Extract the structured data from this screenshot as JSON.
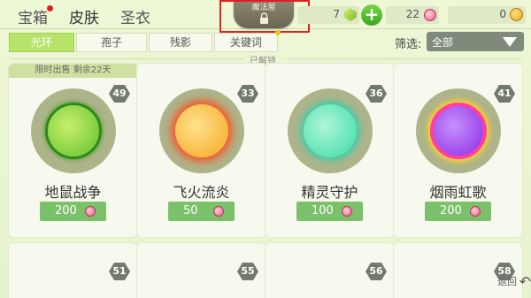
{
  "top_tabs": [
    {
      "label": "宝箱",
      "has_dot": true
    },
    {
      "label": "皮肤",
      "active": true
    },
    {
      "label": "圣衣"
    }
  ],
  "lock": {
    "label": "魔法屋"
  },
  "currency": {
    "green_gem": "7",
    "candy": "22",
    "gold": "0",
    "plus": "+"
  },
  "sub_tabs": [
    {
      "label": "光环",
      "active": true
    },
    {
      "label": "孢子"
    },
    {
      "label": "残影"
    },
    {
      "label": "关键词"
    }
  ],
  "filter": {
    "label": "筛选:",
    "value": "全部"
  },
  "section_label": "已解锁",
  "banner": "限时出售 剩余22天",
  "cards": [
    {
      "name": "地鼠战争",
      "level": "49",
      "price": "200",
      "color": "#7bdc43"
    },
    {
      "name": "飞火流炎",
      "level": "33",
      "price": "50",
      "color": "#f5a623"
    },
    {
      "name": "精灵守护",
      "level": "36",
      "price": "100",
      "color": "#55e8b0"
    },
    {
      "name": "烟雨虹歌",
      "level": "41",
      "price": "200",
      "color": "#a24ff0"
    }
  ],
  "bottom_levels": [
    "51",
    "55",
    "56",
    "58"
  ],
  "back": {
    "label": "返回"
  }
}
